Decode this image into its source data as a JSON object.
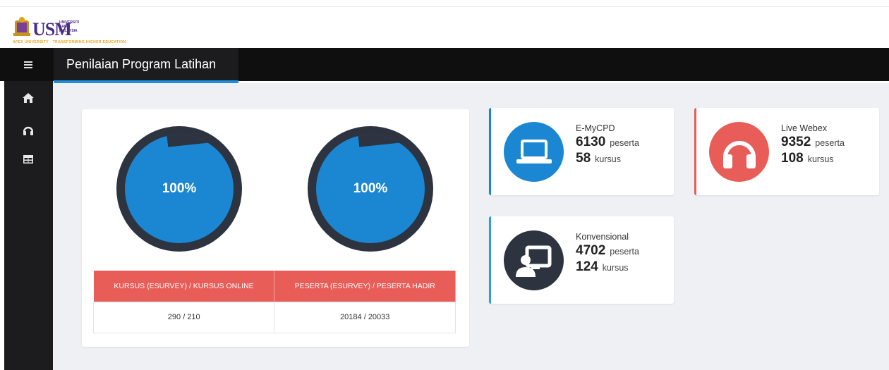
{
  "brand": {
    "logo_text": "USM",
    "logo_small": "UNIVERSITI SAINS MALAYSIA",
    "tagline": "APEX UNIVERSITY · TRANSFORMING HIGHER EDUCATION"
  },
  "header": {
    "page_title": "Penilaian Program Latihan"
  },
  "sidebar": {
    "items": [
      {
        "icon": "home-icon"
      },
      {
        "icon": "headphones-icon"
      },
      {
        "icon": "table-icon"
      }
    ]
  },
  "summary": {
    "gauges": [
      {
        "label": "100%",
        "value": 100
      },
      {
        "label": "100%",
        "value": 100
      }
    ],
    "table": {
      "headers": [
        "KURSUS (ESURVEY) / KURSUS ONLINE",
        "PESERTA (ESURVEY) / PESERTA HADIR"
      ],
      "values": [
        "290 / 210",
        "20184 / 20033"
      ]
    }
  },
  "cards": {
    "emycpd": {
      "title": "E-MyCPD",
      "peserta": "6130",
      "peserta_label": "peserta",
      "kursus": "58",
      "kursus_label": "kursus",
      "icon": "laptop-icon",
      "color": "#1b87d3"
    },
    "webex": {
      "title": "Live Webex",
      "peserta": "9352",
      "peserta_label": "peserta",
      "kursus": "108",
      "kursus_label": "kursus",
      "icon": "headphones-icon",
      "color": "#e85d57"
    },
    "konvensional": {
      "title": "Konvensional",
      "peserta": "4702",
      "peserta_label": "peserta",
      "kursus": "124",
      "kursus_label": "kursus",
      "icon": "presenter-icon",
      "color": "#2e3340"
    }
  }
}
